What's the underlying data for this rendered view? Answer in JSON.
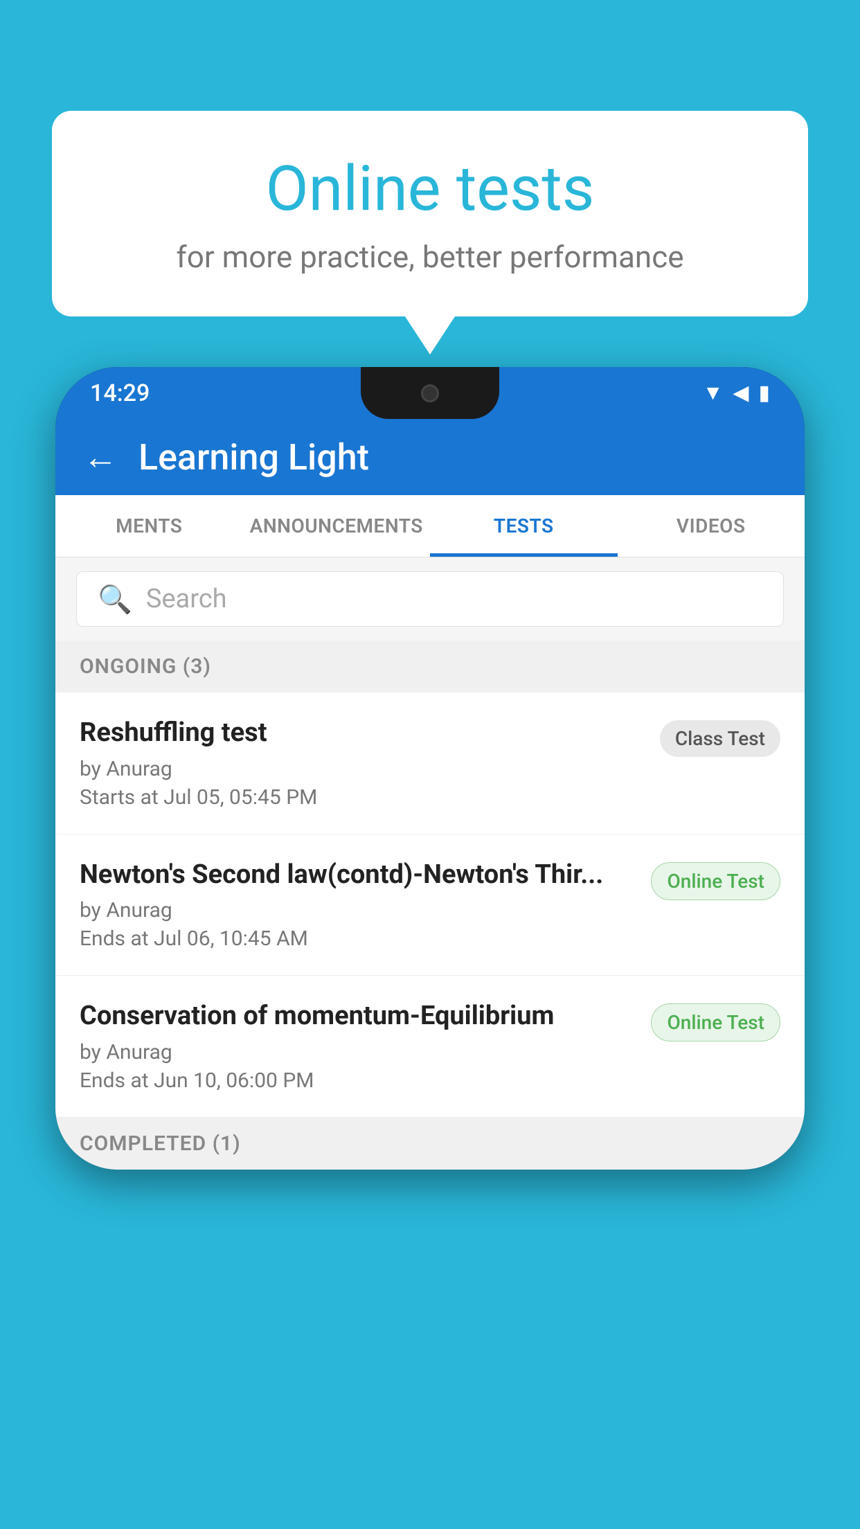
{
  "background_color": "#29b6d8",
  "speech_bubble": {
    "title": "Online tests",
    "subtitle": "for more practice, better performance"
  },
  "phone": {
    "status_bar": {
      "time": "14:29",
      "wifi_icon": "▼",
      "signal_icon": "◀",
      "battery_icon": "▮"
    },
    "app_bar": {
      "title": "Learning Light",
      "back_label": "←"
    },
    "tabs": [
      {
        "label": "MENTS",
        "active": false
      },
      {
        "label": "ANNOUNCEMENTS",
        "active": false
      },
      {
        "label": "TESTS",
        "active": true
      },
      {
        "label": "VIDEOS",
        "active": false
      }
    ],
    "search": {
      "placeholder": "Search",
      "icon": "🔍"
    },
    "ongoing_section": {
      "header": "ONGOING (3)",
      "tests": [
        {
          "name": "Reshuffling test",
          "by": "by Anurag",
          "time": "Starts at  Jul 05, 05:45 PM",
          "badge": "Class Test",
          "badge_type": "class"
        },
        {
          "name": "Newton's Second law(contd)-Newton's Thir...",
          "by": "by Anurag",
          "time": "Ends at  Jul 06, 10:45 AM",
          "badge": "Online Test",
          "badge_type": "online"
        },
        {
          "name": "Conservation of momentum-Equilibrium",
          "by": "by Anurag",
          "time": "Ends at  Jun 10, 06:00 PM",
          "badge": "Online Test",
          "badge_type": "online"
        }
      ]
    },
    "completed_section": {
      "header": "COMPLETED (1)"
    }
  }
}
